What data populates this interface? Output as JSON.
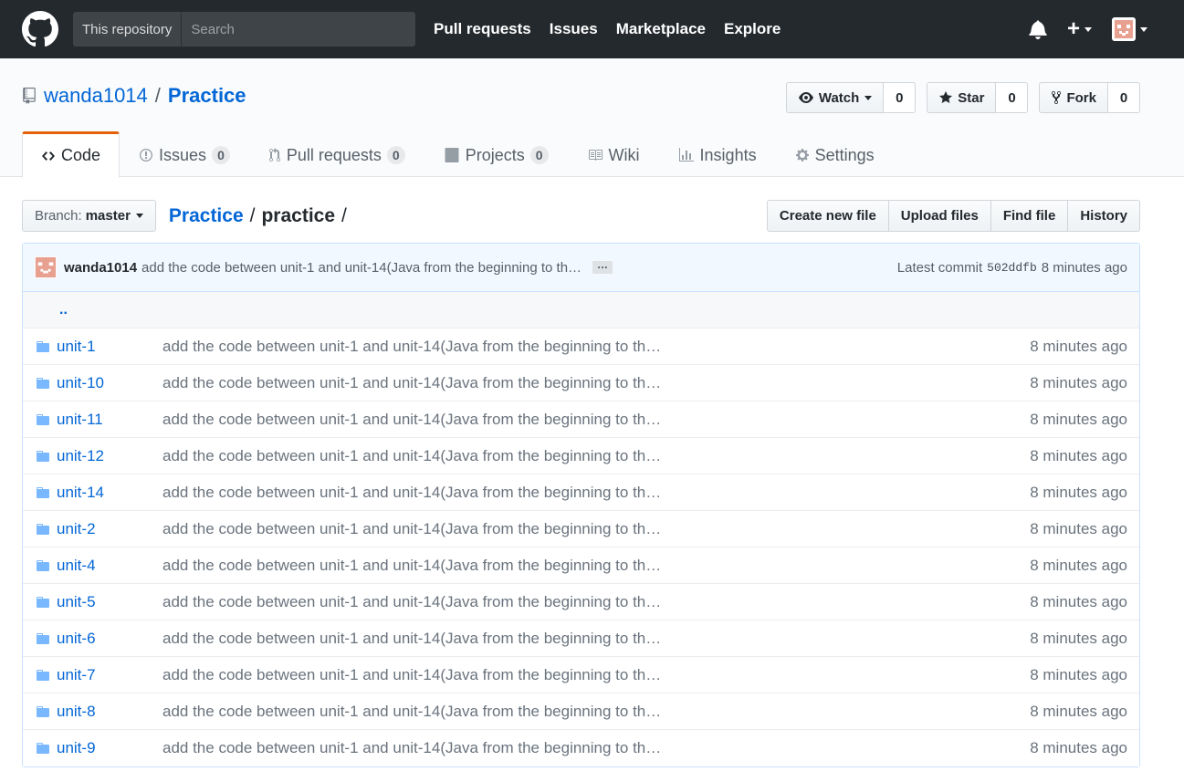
{
  "header": {
    "search_scope": "This repository",
    "search_placeholder": "Search",
    "nav": [
      "Pull requests",
      "Issues",
      "Marketplace",
      "Explore"
    ]
  },
  "repo": {
    "owner": "wanda1014",
    "separator": "/",
    "name": "Practice",
    "watch_label": "Watch",
    "watch_count": "0",
    "star_label": "Star",
    "star_count": "0",
    "fork_label": "Fork",
    "fork_count": "0"
  },
  "tabs": [
    {
      "label": "Code",
      "icon": "code-icon"
    },
    {
      "label": "Issues",
      "count": "0",
      "icon": "issue-icon"
    },
    {
      "label": "Pull requests",
      "count": "0",
      "icon": "pull-request-icon"
    },
    {
      "label": "Projects",
      "count": "0",
      "icon": "project-icon"
    },
    {
      "label": "Wiki",
      "icon": "book-icon"
    },
    {
      "label": "Insights",
      "icon": "graph-icon"
    },
    {
      "label": "Settings",
      "icon": "gear-icon"
    }
  ],
  "file_nav": {
    "branch_label": "Branch:",
    "branch_value": "master",
    "breadcrumb_root": "Practice",
    "breadcrumb_current": "practice",
    "slash": "/",
    "actions": [
      "Create new file",
      "Upload files",
      "Find file",
      "History"
    ]
  },
  "commit": {
    "author": "wanda1014",
    "message": "add the code between unit-1 and unit-14(Java from the beginning to th…",
    "ellipsis": "…",
    "latest_label": "Latest commit",
    "sha": "502ddfb",
    "age": "8 minutes ago"
  },
  "up_link": "..",
  "files": [
    {
      "name": "unit-1",
      "message": "add the code between unit-1 and unit-14(Java from the beginning to th…",
      "age": "8 minutes ago"
    },
    {
      "name": "unit-10",
      "message": "add the code between unit-1 and unit-14(Java from the beginning to th…",
      "age": "8 minutes ago"
    },
    {
      "name": "unit-11",
      "message": "add the code between unit-1 and unit-14(Java from the beginning to th…",
      "age": "8 minutes ago"
    },
    {
      "name": "unit-12",
      "message": "add the code between unit-1 and unit-14(Java from the beginning to th…",
      "age": "8 minutes ago"
    },
    {
      "name": "unit-14",
      "message": "add the code between unit-1 and unit-14(Java from the beginning to th…",
      "age": "8 minutes ago"
    },
    {
      "name": "unit-2",
      "message": "add the code between unit-1 and unit-14(Java from the beginning to th…",
      "age": "8 minutes ago"
    },
    {
      "name": "unit-4",
      "message": "add the code between unit-1 and unit-14(Java from the beginning to th…",
      "age": "8 minutes ago"
    },
    {
      "name": "unit-5",
      "message": "add the code between unit-1 and unit-14(Java from the beginning to th…",
      "age": "8 minutes ago"
    },
    {
      "name": "unit-6",
      "message": "add the code between unit-1 and unit-14(Java from the beginning to th…",
      "age": "8 minutes ago"
    },
    {
      "name": "unit-7",
      "message": "add the code between unit-1 and unit-14(Java from the beginning to th…",
      "age": "8 minutes ago"
    },
    {
      "name": "unit-8",
      "message": "add the code between unit-1 and unit-14(Java from the beginning to th…",
      "age": "8 minutes ago"
    },
    {
      "name": "unit-9",
      "message": "add the code between unit-1 and unit-14(Java from the beginning to th…",
      "age": "8 minutes ago"
    }
  ],
  "colors": {
    "header_bg": "#24292e",
    "link": "#0366d6",
    "tab_accent": "#e36209",
    "folder": "#79b8ff",
    "commit_bg": "#f1f8ff"
  }
}
